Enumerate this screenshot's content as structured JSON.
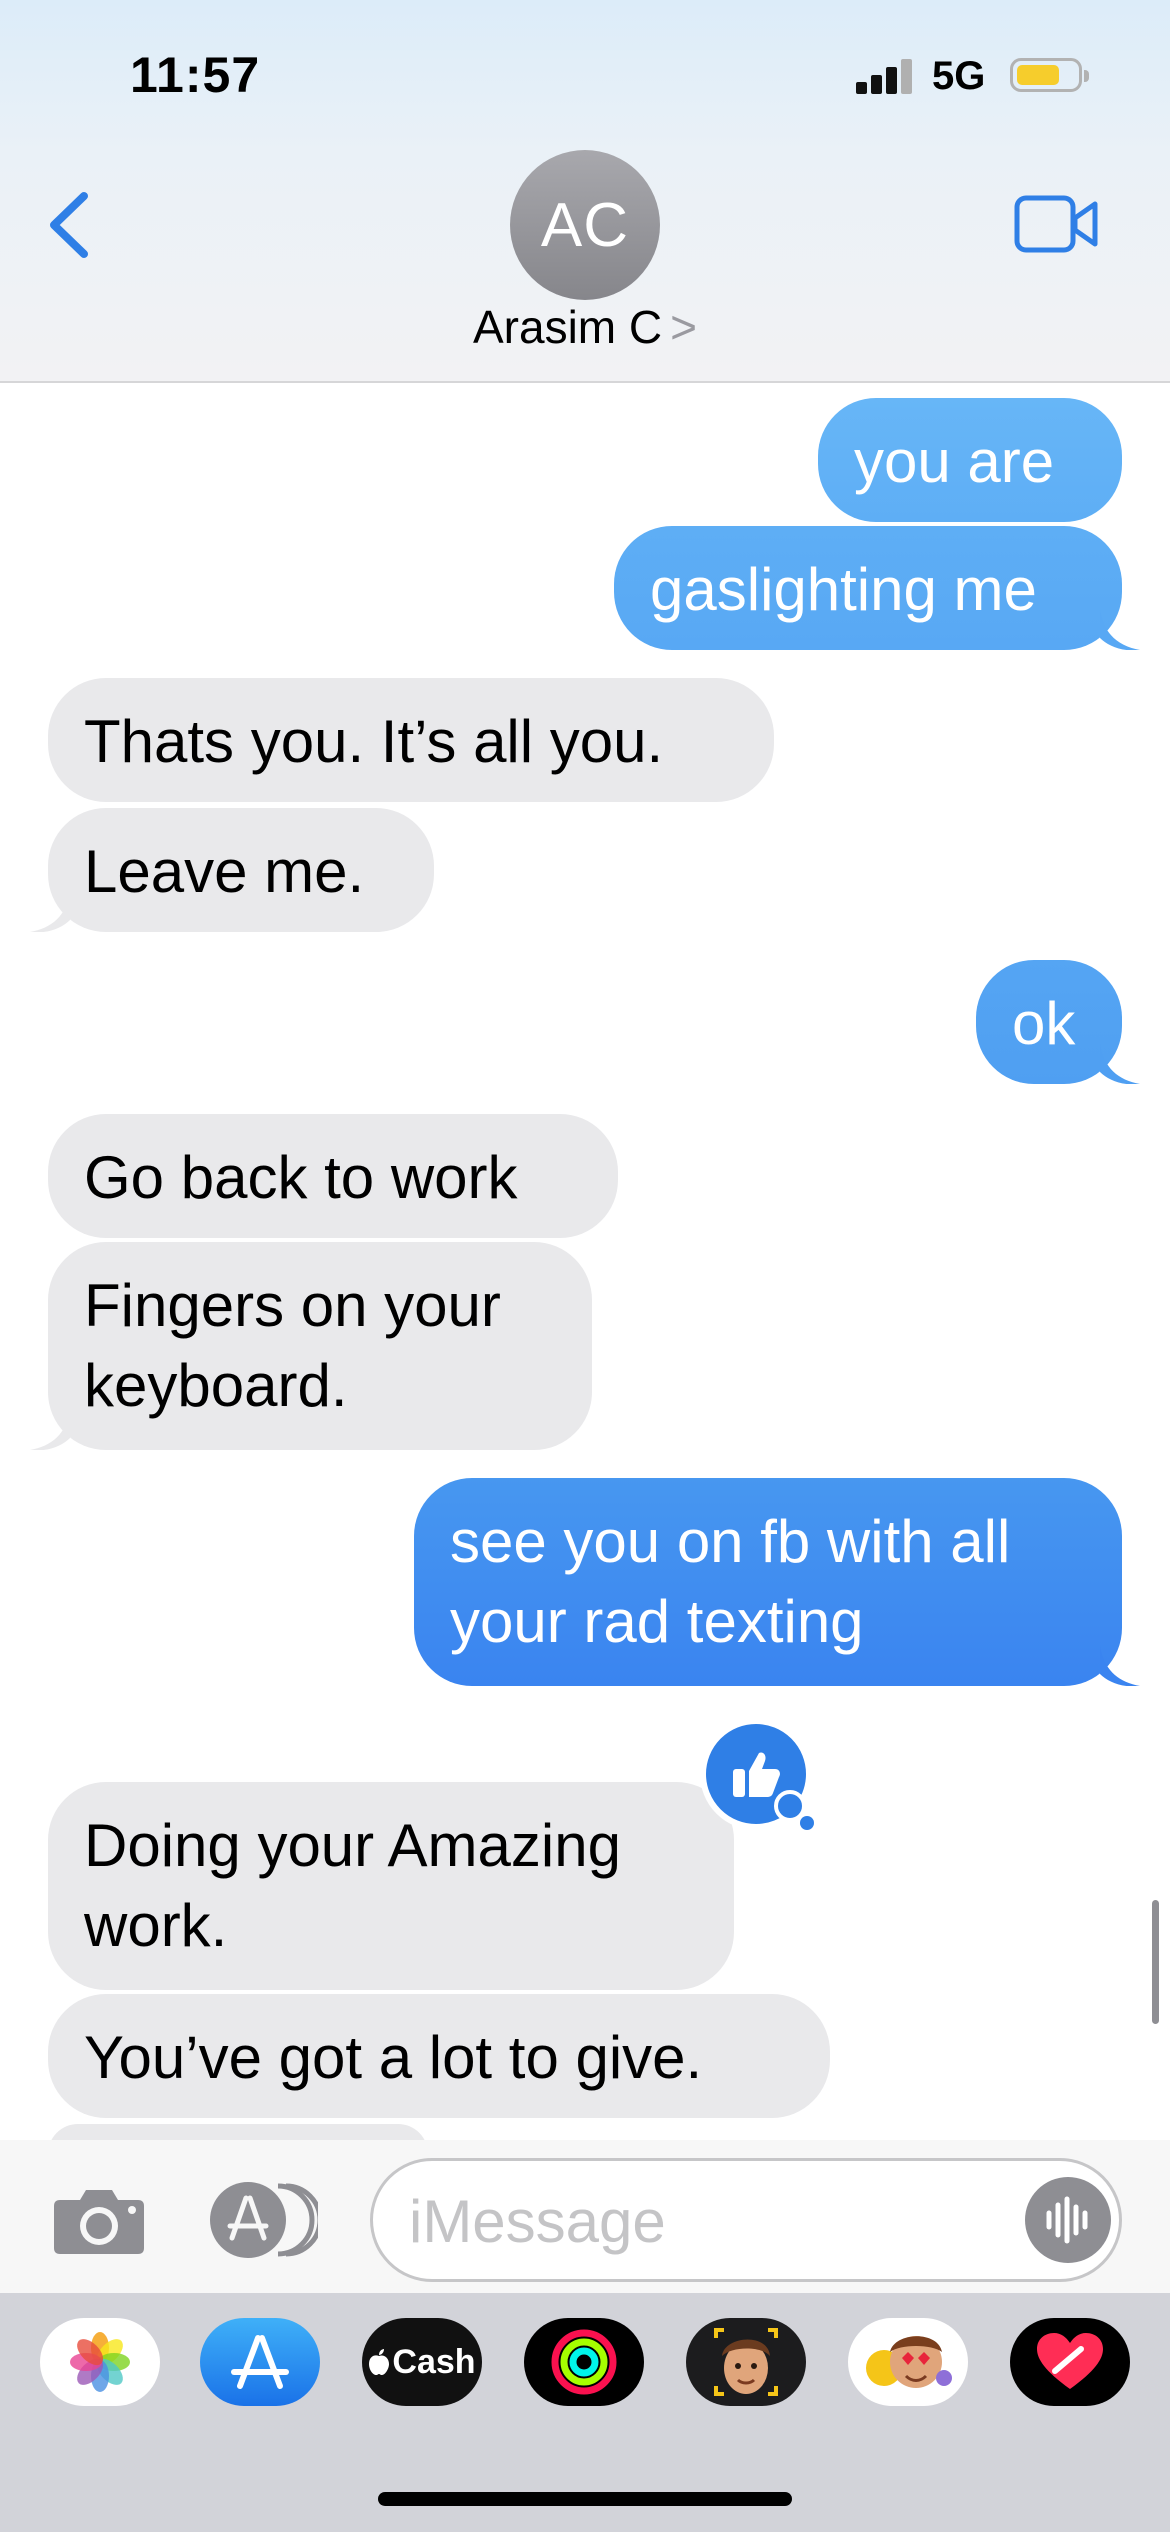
{
  "status_bar": {
    "time": "11:57",
    "network": "5G"
  },
  "header": {
    "avatar_initials": "AC",
    "contact_name": "Arasim C",
    "contact_chevron": ">"
  },
  "messages": [
    {
      "text": "you are",
      "direction": "out"
    },
    {
      "text": "gaslighting me",
      "direction": "out"
    },
    {
      "text": "Thats you.  It’s all you.",
      "direction": "in"
    },
    {
      "text": "Leave me.",
      "direction": "in"
    },
    {
      "text": "ok",
      "direction": "out"
    },
    {
      "text": "Go back to work",
      "direction": "in"
    },
    {
      "line1": "Fingers on your",
      "line2": "keyboard.",
      "direction": "in"
    },
    {
      "line1": "see you on fb with all",
      "line2": "your rad texting",
      "direction": "out"
    },
    {
      "line1": "Doing your Amazing",
      "line2": "work.",
      "direction": "in",
      "tapback": "thumbs-up-icon"
    },
    {
      "text": "You’ve got a lot to give.",
      "direction": "in"
    }
  ],
  "input": {
    "placeholder": "iMessage"
  },
  "app_drawer": {
    "apps": [
      {
        "name": "photos-app-icon"
      },
      {
        "name": "app-store-app-icon"
      },
      {
        "name": "apple-cash-app-icon",
        "label": "Cash"
      },
      {
        "name": "fitness-activity-app-icon"
      },
      {
        "name": "memoji-stickers-app-icon"
      },
      {
        "name": "animoji-stickers-app-icon"
      },
      {
        "name": "digital-touch-app-icon"
      }
    ]
  },
  "colors": {
    "incoming_bubble": "#e9e9eb",
    "outgoing_bubble_top": "#5eb0f5",
    "outgoing_bubble_bottom": "#3a84f0",
    "tint": "#2f7fe6"
  }
}
